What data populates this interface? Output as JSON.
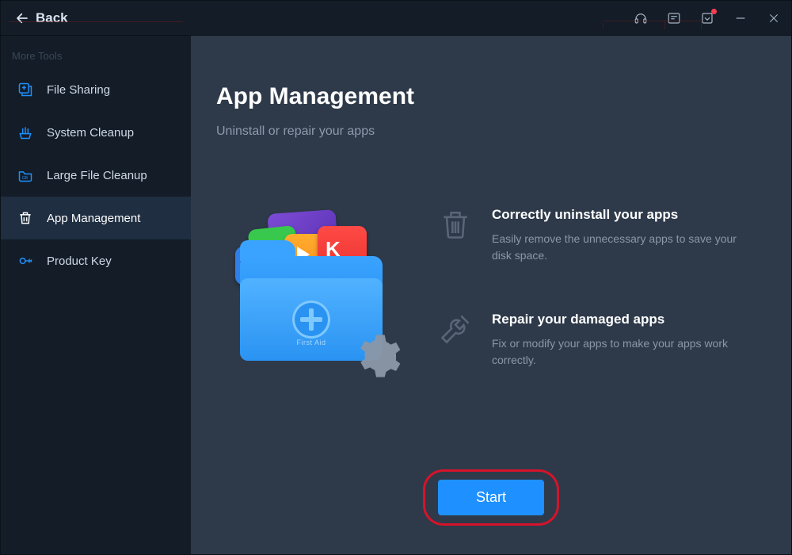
{
  "titlebar": {
    "back_label": "Back"
  },
  "sidebar": {
    "header": "More Tools",
    "items": [
      {
        "label": "File Sharing"
      },
      {
        "label": "System Cleanup"
      },
      {
        "label": "Large File Cleanup"
      },
      {
        "label": "App Management"
      },
      {
        "label": "Product Key"
      }
    ]
  },
  "main": {
    "title": "App Management",
    "subtitle": "Uninstall or repair your apps",
    "illustration_caption": "First Aid",
    "features": [
      {
        "title": "Correctly uninstall your apps",
        "desc": "Easily remove the unnecessary apps to save your disk space."
      },
      {
        "title": "Repair your damaged apps",
        "desc": "Fix or modify your apps to make your apps work correctly."
      }
    ],
    "start_label": "Start"
  }
}
